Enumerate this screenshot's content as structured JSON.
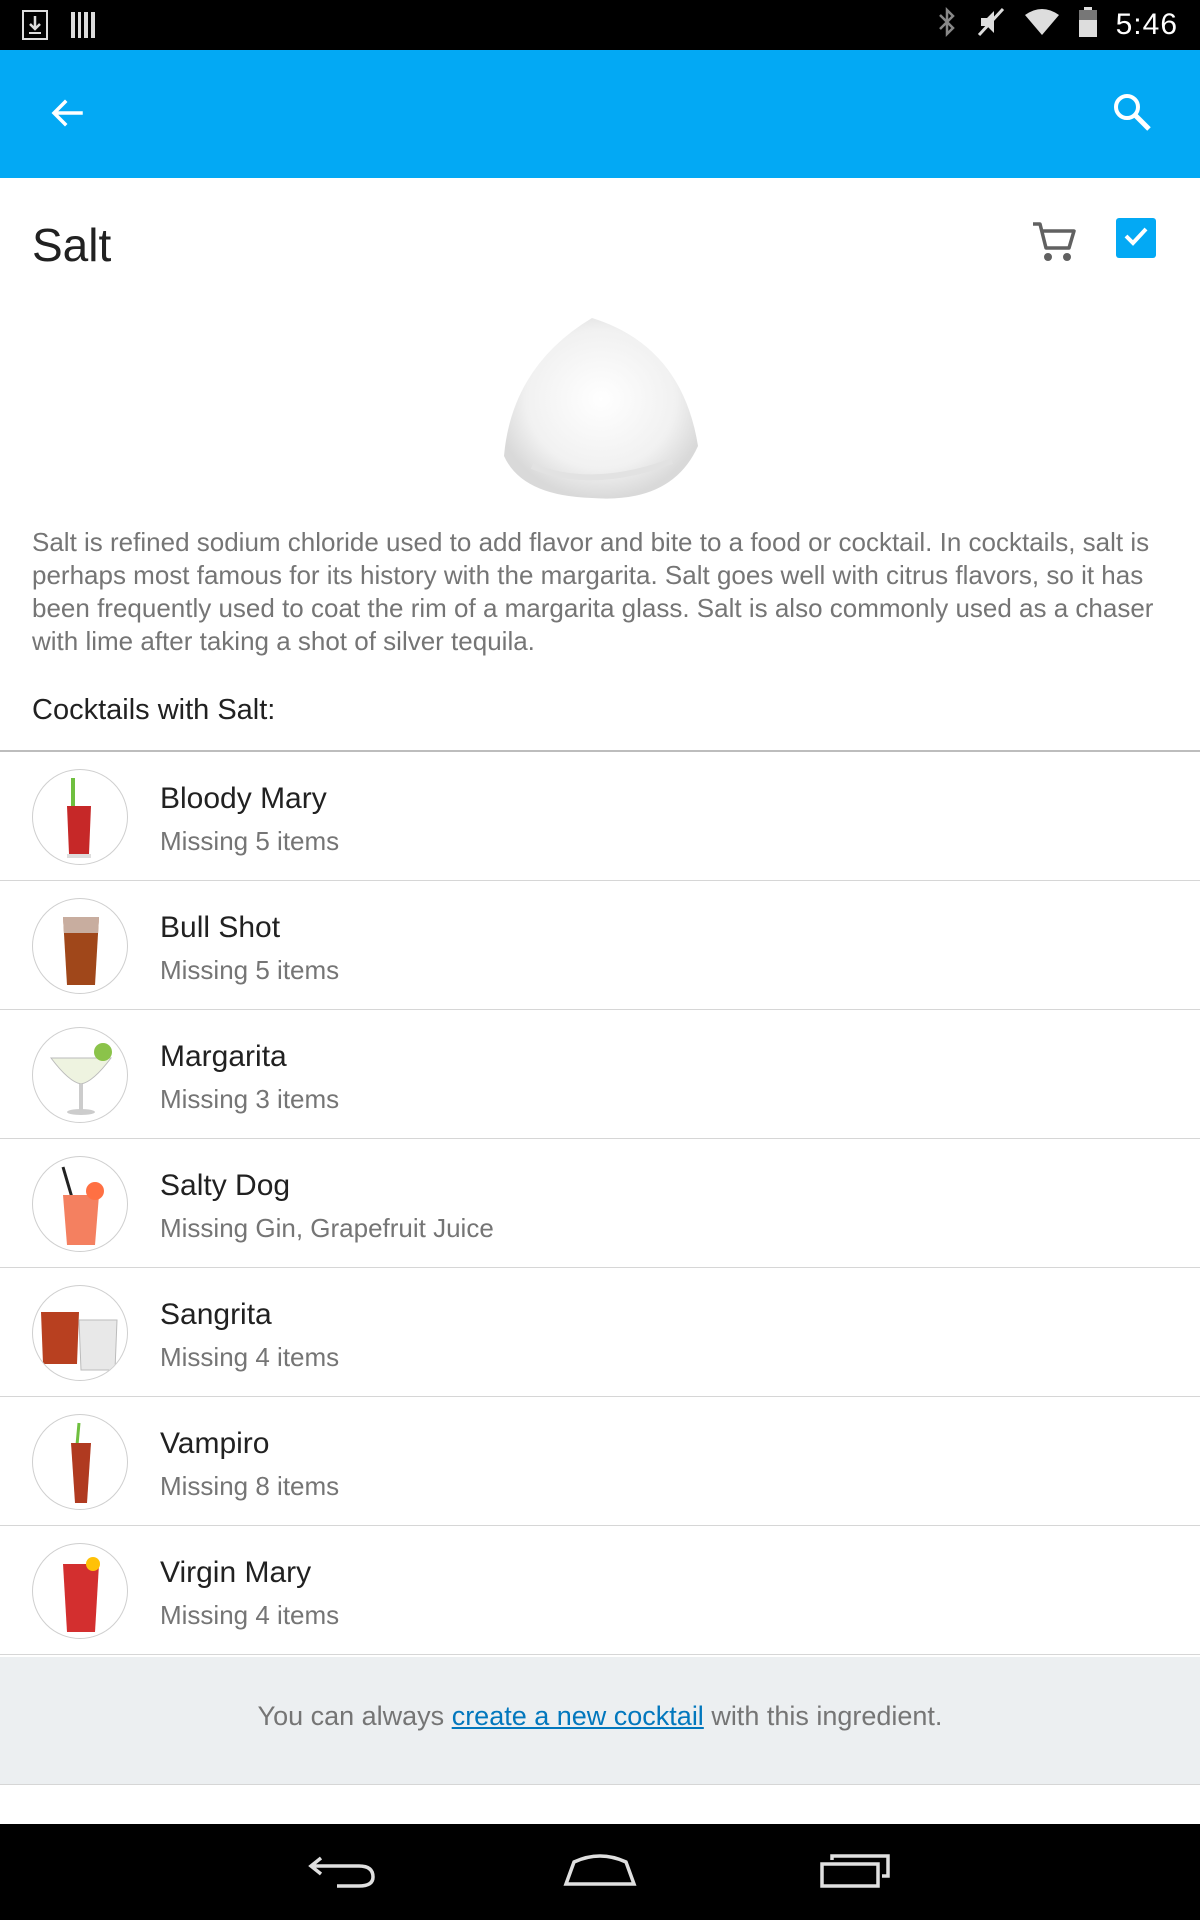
{
  "status_bar": {
    "time": "5:46",
    "left_icons": [
      "download-icon",
      "barcode-icon"
    ],
    "right_icons": [
      "bluetooth-icon",
      "mute-icon",
      "wifi-icon",
      "battery-icon"
    ]
  },
  "app_bar": {
    "color": "#03a9f4",
    "back_icon": "arrow-back-icon",
    "search_icon": "search-icon"
  },
  "ingredient": {
    "name": "Salt",
    "actions": [
      "cart-icon",
      "checkbox-checked-icon"
    ],
    "description": "Salt is refined sodium chloride used to add flavor and bite to a food or cocktail. In cocktails, salt is perhaps most famous for its history with the margarita. Salt goes well with citrus flavors, so it has been frequently used to coat the rim of a margarita glass. Salt is also commonly used as a chaser with lime after taking a shot of silver tequila."
  },
  "section_heading": "Cocktails with Salt:",
  "cocktails": [
    {
      "name": "Bloody Mary",
      "status": "Missing 5 items",
      "drink_color": "#c62828"
    },
    {
      "name": "Bull Shot",
      "status": "Missing 5 items",
      "drink_color": "#a0471a"
    },
    {
      "name": "Margarita",
      "status": "Missing 3 items",
      "drink_color": "#eef3e0"
    },
    {
      "name": "Salty Dog",
      "status": "Missing Gin, Grapefruit Juice",
      "drink_color": "#f48060"
    },
    {
      "name": "Sangrita",
      "status": "Missing 4 items",
      "drink_color": "#b84020"
    },
    {
      "name": "Vampiro",
      "status": "Missing 8 items",
      "drink_color": "#b03a20"
    },
    {
      "name": "Virgin Mary",
      "status": "Missing 4 items",
      "drink_color": "#d32f2f"
    }
  ],
  "footer": {
    "prefix": "You can always ",
    "link": "create a new cocktail",
    "suffix": " with this ingredient."
  },
  "nav_bar": {
    "buttons": [
      "back-nav-icon",
      "home-nav-icon",
      "recents-nav-icon"
    ]
  }
}
